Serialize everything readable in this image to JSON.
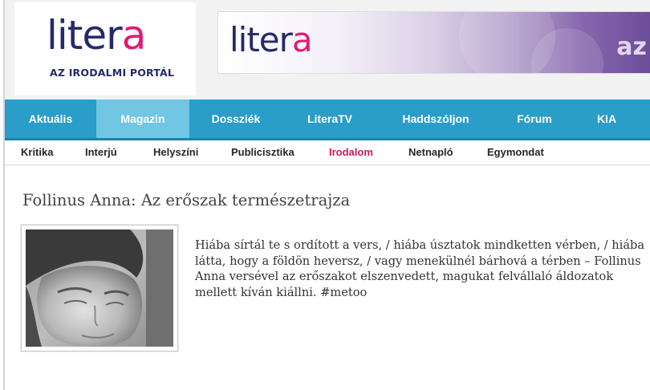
{
  "header": {
    "logo": {
      "text_main": "liter",
      "text_accent": "a",
      "tagline": "AZ IRODALMI PORTÁL"
    },
    "banner": {
      "logo_main": "liter",
      "logo_accent": "a",
      "side_text": "az"
    }
  },
  "main_nav": {
    "items": [
      {
        "label": "Aktuális"
      },
      {
        "label": "Magazin",
        "active": true
      },
      {
        "label": "Dossziék"
      },
      {
        "label": "LiteraTV"
      },
      {
        "label": "Haddszóljon"
      },
      {
        "label": "Fórum"
      },
      {
        "label": "KIA"
      }
    ]
  },
  "sub_nav": {
    "items": [
      {
        "label": "Kritika"
      },
      {
        "label": "Interjú"
      },
      {
        "label": "Helyszíni"
      },
      {
        "label": "Publicisztika"
      },
      {
        "label": "Irodalom",
        "active": true
      },
      {
        "label": "Netnapló"
      },
      {
        "label": "Egymondat"
      }
    ]
  },
  "article": {
    "title": "Follinus Anna: Az erőszak természetrajza",
    "lead": "Hiába sírtál te s ordított a vers, / hiába úsztatok mindketten vérben, / hiába látta, hogy a földön heversz, / vagy menekülnél bárhová a térben – Follinus Anna versével az erőszakot elszenvedett, magukat felvállaló áldozatok mellett kíván kiállni. #metoo"
  },
  "colors": {
    "brand_navy": "#262a6a",
    "brand_pink": "#e21a74",
    "nav_blue": "#2a9dc8",
    "nav_active": "#70c6e3",
    "subnav_active": "#c9185f"
  }
}
